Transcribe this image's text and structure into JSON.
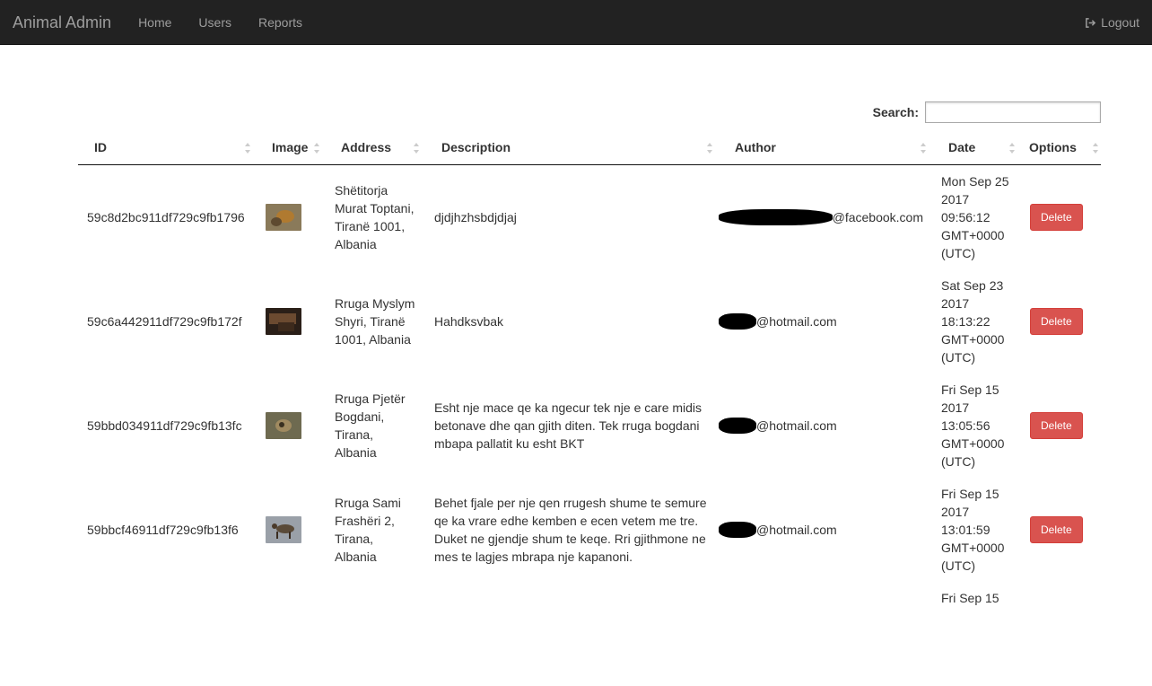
{
  "navbar": {
    "brand": "Animal Admin",
    "links": [
      "Home",
      "Users",
      "Reports"
    ],
    "logout": "Logout"
  },
  "search": {
    "label": "Search:",
    "value": ""
  },
  "table": {
    "headers": [
      "ID",
      "Image",
      "Address",
      "Description",
      "Author",
      "Date",
      "Options"
    ],
    "rows": [
      {
        "id": "59c8d2bc911df729c9fb1796",
        "address": "Shëtitorja Murat Toptani, Tiranë 1001, Albania",
        "description": "djdjhzhsbdjdjaj",
        "author_domain": "@facebook.com",
        "date": "Mon Sep 25 2017 09:56:12 GMT+0000 (UTC)",
        "action": "Delete"
      },
      {
        "id": "59c6a442911df729c9fb172f",
        "address": "Rruga Myslym Shyri, Tiranë 1001, Albania",
        "description": "Hahdksvbak",
        "author_domain": "@hotmail.com",
        "date": "Sat Sep 23 2017 18:13:22 GMT+0000 (UTC)",
        "action": "Delete"
      },
      {
        "id": "59bbd034911df729c9fb13fc",
        "address": "Rruga Pjetër Bogdani, Tirana, Albania",
        "description": "Esht nje mace qe ka ngecur tek nje e care midis betonave dhe qan gjith diten. Tek rruga bogdani mbapa pallatit ku esht BKT",
        "author_domain": "@hotmail.com",
        "date": "Fri Sep 15 2017 13:05:56 GMT+0000 (UTC)",
        "action": "Delete"
      },
      {
        "id": "59bbcf46911df729c9fb13f6",
        "address": "Rruga Sami Frashëri 2, Tirana, Albania",
        "description": "Behet fjale per nje qen rrugesh shume te semure qe ka vrare edhe kemben e ecen vetem me tre. Duket ne gjendje shum te keqe. Rri gjithmone ne mes te lagjes mbrapa nje kapanoni.",
        "author_domain": "@hotmail.com",
        "date": "Fri Sep 15 2017 13:01:59 GMT+0000 (UTC)",
        "action": "Delete"
      }
    ],
    "partial_row_date": "Fri Sep 15"
  },
  "colors": {
    "navbar": "#222222",
    "delete": "#d9534f"
  }
}
